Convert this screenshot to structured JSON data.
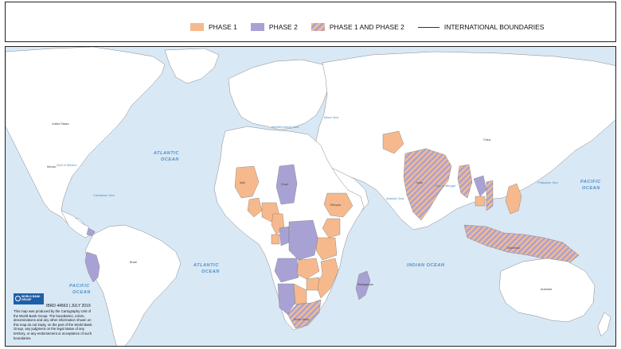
{
  "legend": {
    "items": [
      {
        "label": "PHASE 1",
        "color": "#f6b98d"
      },
      {
        "label": "PHASE 2",
        "color": "#a8a2d4"
      },
      {
        "label": "PHASE 1 AND PHASE 2",
        "color": "striped"
      },
      {
        "label": "INTERNATIONAL BOUNDARIES",
        "color": "#333333"
      }
    ]
  },
  "colors": {
    "ocean": "#d9e8f5",
    "land": "#ffffff",
    "phase1": "#f6b98d",
    "phase2": "#a8a2d4",
    "water_label": "#4a8fc9"
  },
  "oceans": [
    "ATLANTIC",
    "OCEAN",
    "PACIFIC",
    "INDIAN OCEAN"
  ],
  "seas": [
    "Gulf of Mexico",
    "Caribbean Sea",
    "Mediterranean Sea",
    "Black Sea",
    "Arabian Sea",
    "Bay of Bengal",
    "Philippine Sea"
  ],
  "countries": {
    "phase1": [
      "Mali",
      "Burkina Faso",
      "Ghana",
      "Nigeria",
      "Cameroon",
      "Gabon",
      "Ethiopia",
      "Kenya",
      "Tanzania",
      "Zambia",
      "Mozambique",
      "Zimbabwe",
      "Botswana",
      "Afghanistan",
      "Cambodia",
      "Philippines"
    ],
    "phase2": [
      "Chad",
      "Congo",
      "Dem. Rep. of Congo",
      "Angola",
      "Namibia",
      "Madagascar",
      "Lao PDR",
      "Peru",
      "Panama"
    ],
    "phase12": [
      "India",
      "Indonesia",
      "South Africa",
      "Myanmar",
      "Vietnam"
    ],
    "other": [
      "United States",
      "Mexico",
      "Brazil",
      "Colombia",
      "Venezuela",
      "Guyana",
      "Suriname",
      "Bolivia",
      "Argentina",
      "Chile",
      "Uruguay",
      "Paraguay",
      "Ecuador",
      "Costa Rica",
      "Morocco",
      "Algeria",
      "Libya",
      "Egypt",
      "Sudan",
      "South Sudan",
      "Niger",
      "Mauritania",
      "Senegal",
      "Guinea",
      "Central African Rep.",
      "Somalia",
      "Spain",
      "France",
      "Turkey",
      "Ukraine",
      "Kazakhstan",
      "Iran",
      "Pakistan",
      "China",
      "Mongolia",
      "Saudi Arabia",
      "Yemen",
      "Iraq",
      "Bhutan",
      "Sri Lanka",
      "Brunei",
      "Malaysia",
      "Australia",
      "Papua New Guinea",
      "Mauritius",
      "Seychelles",
      "Uzbekistan",
      "Turkmenistan",
      "Kyrgyz Rep.",
      "Tajikistan",
      "Nepal",
      "Bangladesh",
      "Thailand",
      "Japan",
      "Korea"
    ]
  },
  "credit": {
    "logo": "WORLD BANK GROUP",
    "id": "IBRD 44563 | JULY 2019",
    "disclaimer": "This map was produced by the Cartography Unit of the World Bank Group. The boundaries, colors, denominations and any other information shown on this map do not imply, on the part of the World Bank Group, any judgment on the legal status of any territory, or any endorsement or acceptance of such boundaries."
  }
}
